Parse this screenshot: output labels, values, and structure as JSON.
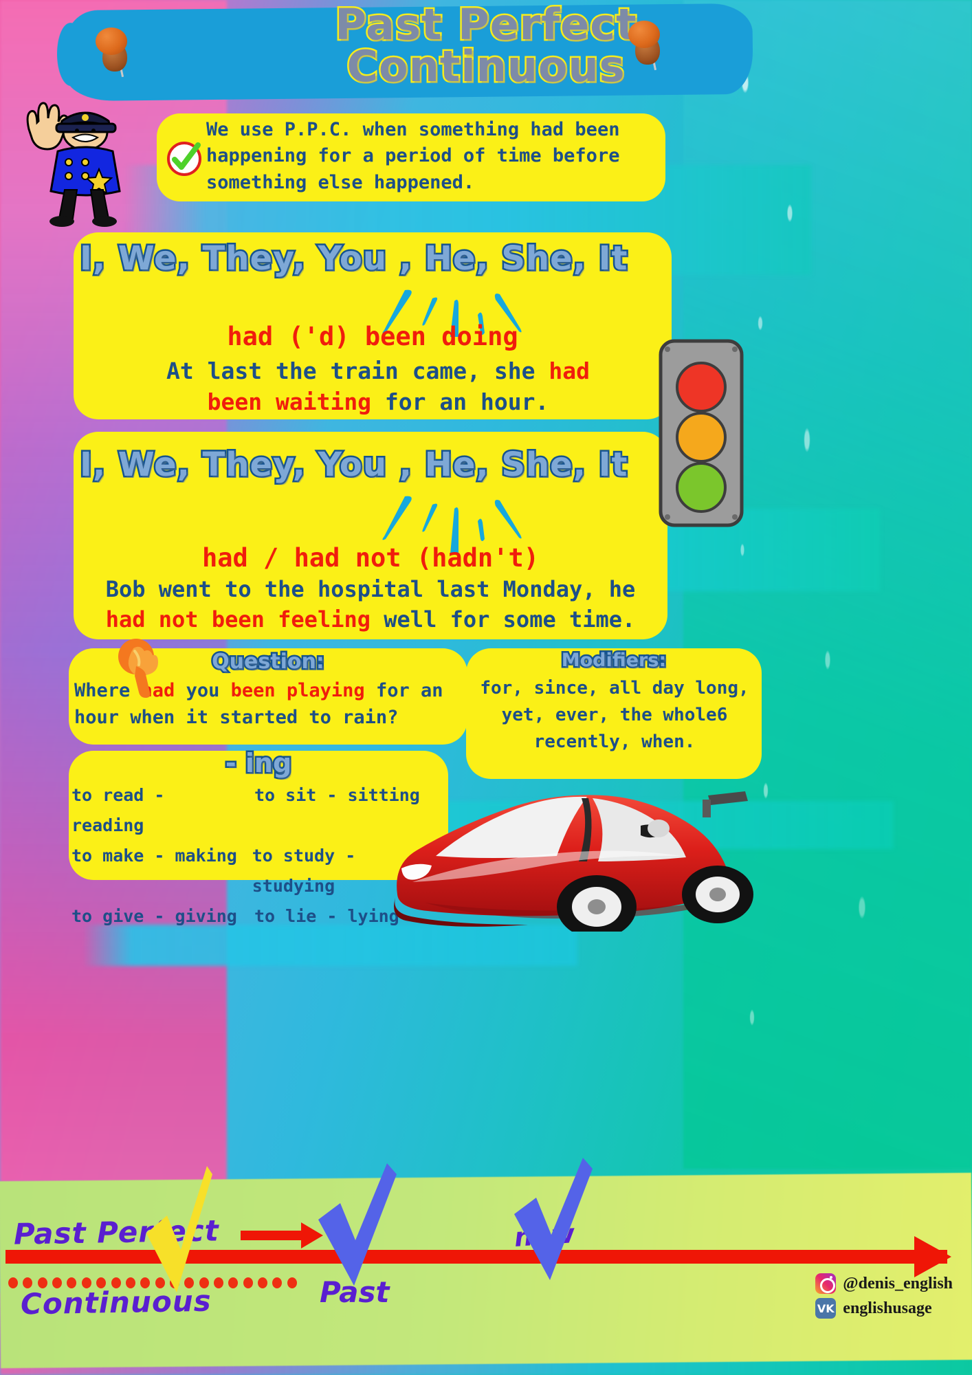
{
  "title": {
    "line1": "Past Perfect",
    "line2": "Continuous"
  },
  "intro": {
    "text": "We use P.P.C. when something had been happening for a period of time before something else happened.",
    "check_icon": "green-check-icon"
  },
  "affirmative": {
    "pronouns": "I, We, They, You , He, She, It",
    "formula_plain": "had ('d) ",
    "formula_red": "been doing",
    "example": [
      {
        "text": "At last the train came, she ",
        "color": "navy"
      },
      {
        "text": "had",
        "color": "red"
      },
      {
        "text": "\n",
        "color": "navy"
      },
      {
        "text": "been waiting",
        "color": "red"
      },
      {
        "text": " for an hour.",
        "color": "navy"
      }
    ],
    "example_plain": "At last the train came, she had been waiting for an hour."
  },
  "negative": {
    "pronouns": "I, We, They, You , He, She, It",
    "formula": "had / had not (hadn't)",
    "example_plain": "Bob went to the hospital last Monday, he had not been feeling well for some time."
  },
  "question": {
    "title": "Question:",
    "text_plain": "Where had you been playing for an hour when it started to rain?",
    "hand_icon": "pointing-hand-icon"
  },
  "modifiers": {
    "title": "Modifiers:",
    "line1": "for, since, all day long,",
    "line2": "yet, ever, the whole6",
    "line3": "recently, when."
  },
  "ing": {
    "title": "- ing",
    "rows": [
      {
        "left": "to read - reading",
        "right": "to sit - sitting"
      },
      {
        "left": "to make - making",
        "right": "to study - studying"
      },
      {
        "left": "to give - giving",
        "right": "to lie - lying"
      }
    ]
  },
  "timeline": {
    "label_line1": "Past Perfect",
    "label_line2": "Continuous",
    "label_past": "Past",
    "label_now": "now",
    "dot_count": 20
  },
  "social": {
    "instagram_handle": "@denis_english",
    "vk_handle": "englishusage",
    "vk_glyph": "VK"
  },
  "decor": {
    "policeman": "policeman-stop-icon",
    "traffic_light": "traffic-light-icon",
    "car": "red-sports-car-icon",
    "pin_left": "push-pin-icon",
    "pin_right": "push-pin-icon"
  },
  "colors": {
    "card_yellow": "#fbf017",
    "text_navy": "#1d4f88",
    "text_red": "#f01d0c",
    "banner_blue": "#1a9ed8",
    "title_fill": "#7d8ba8",
    "title_stroke": "#f5ec1d",
    "bubble_fill": "#7ea8d6",
    "bubble_stroke": "#15538f",
    "timeline_purple": "#5a1fd0",
    "timeline_band": "#c3e87b",
    "timeline_bar": "#ef1606"
  }
}
